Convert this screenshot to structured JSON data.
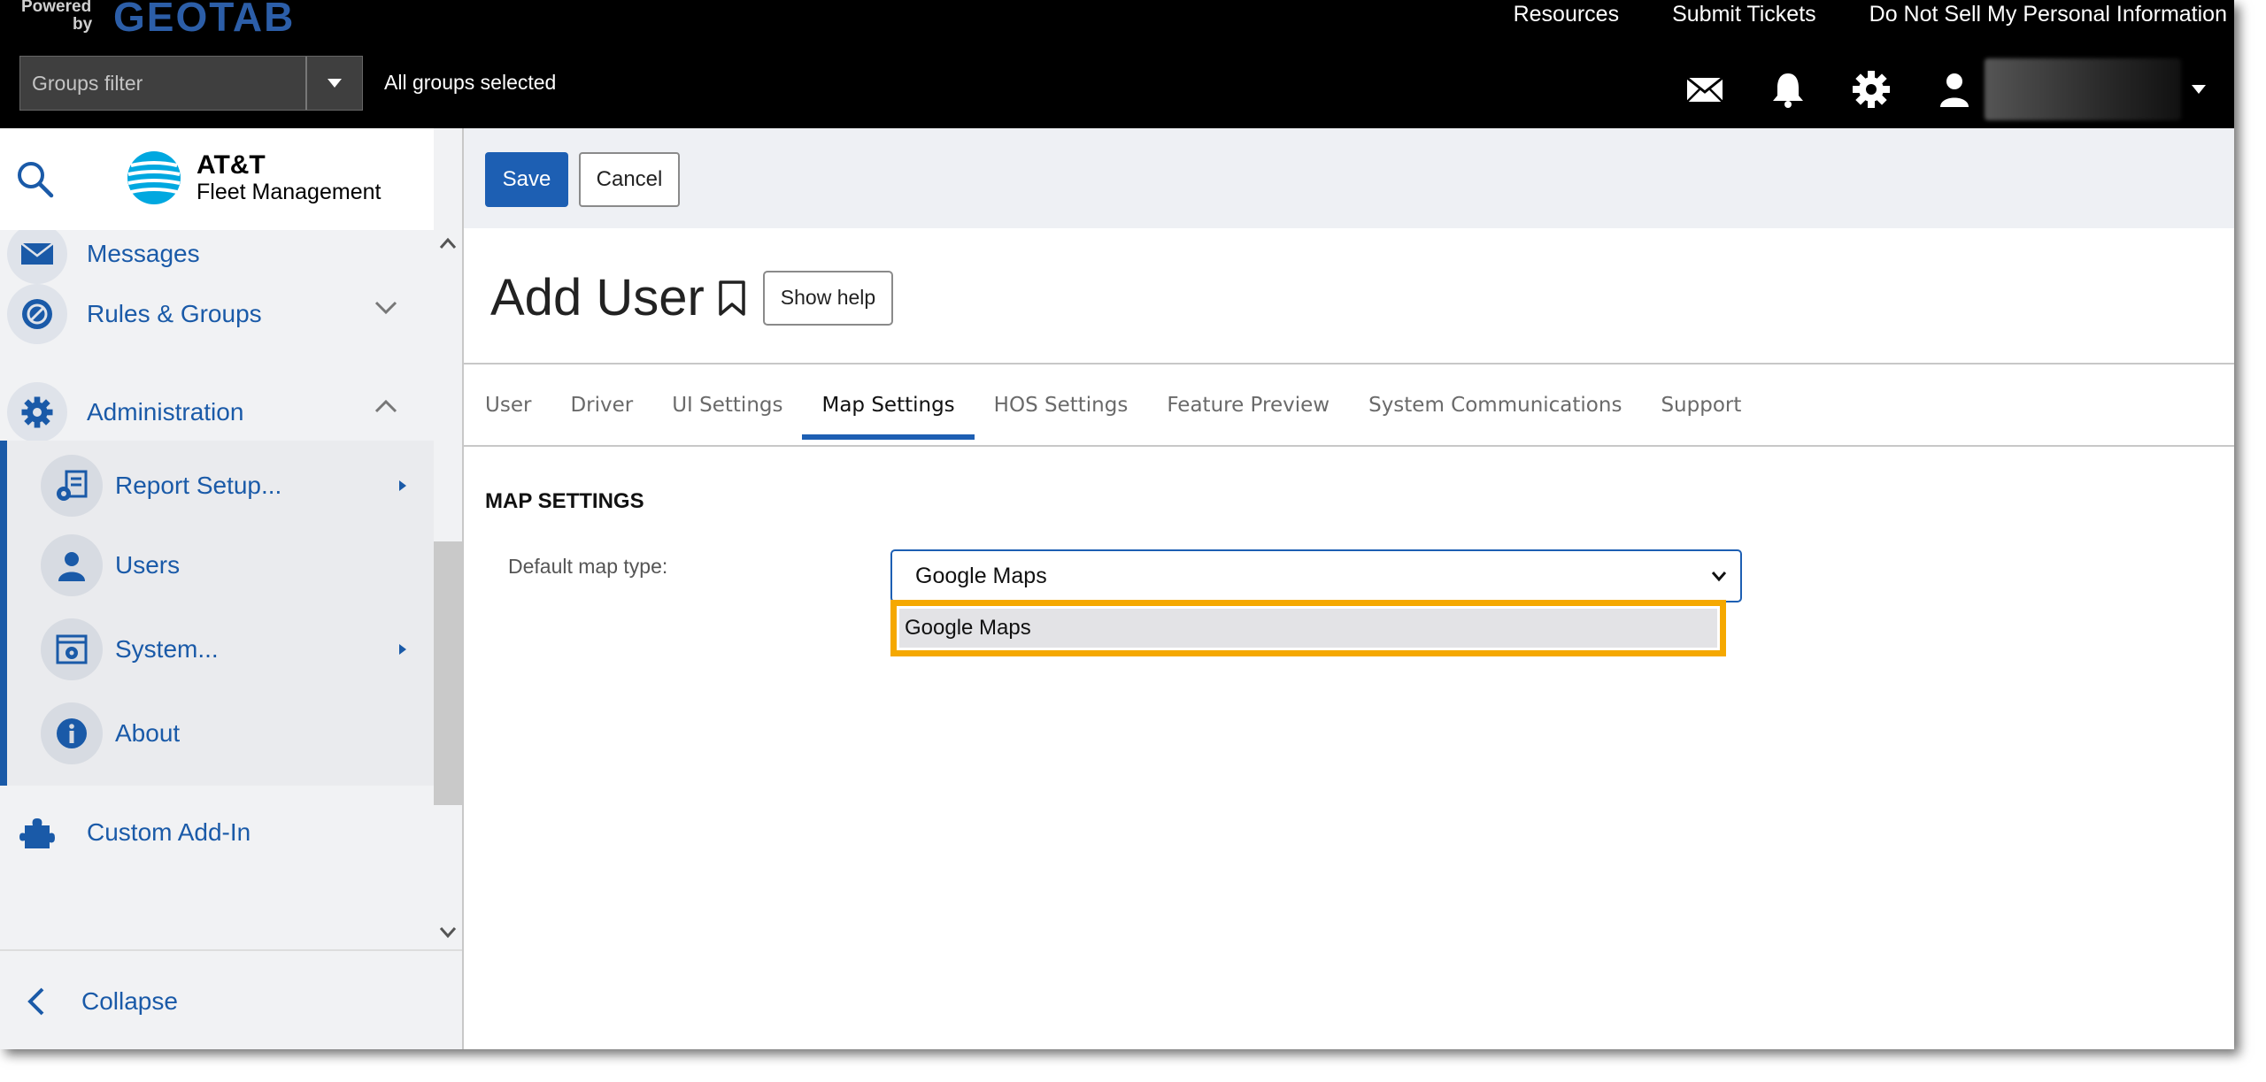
{
  "topbar": {
    "powered": "Powered",
    "by": "by",
    "brand": "GEOTAB",
    "links": [
      "Resources",
      "Submit Tickets",
      "Do Not Sell My Personal Information"
    ],
    "groups_filter_placeholder": "Groups filter",
    "groups_status": "All groups selected",
    "icons": [
      "mail-icon",
      "bell-icon",
      "gear-icon",
      "user-icon"
    ]
  },
  "sidebar": {
    "brand_line1": "AT&T",
    "brand_line2": "Fleet Management",
    "items": [
      {
        "label": "Messages",
        "icon": "envelope-icon"
      },
      {
        "label": "Rules & Groups",
        "icon": "rules-icon",
        "expanded": false
      },
      {
        "label": "Administration",
        "icon": "gear-icon",
        "expanded": true
      }
    ],
    "sub_items": [
      {
        "label": "Report Setup...",
        "icon": "report-setup-icon",
        "has_arrow": true
      },
      {
        "label": "Users",
        "icon": "person-icon",
        "has_arrow": false
      },
      {
        "label": "System...",
        "icon": "system-icon",
        "has_arrow": true
      },
      {
        "label": "About",
        "icon": "info-icon",
        "has_arrow": false
      }
    ],
    "after_items": [
      {
        "label": "Custom Add-In",
        "icon": "puzzle-icon"
      }
    ],
    "collapse_label": "Collapse"
  },
  "toolbar": {
    "save_label": "Save",
    "cancel_label": "Cancel"
  },
  "page": {
    "title": "Add User",
    "help_label": "Show help"
  },
  "tabs": [
    {
      "label": "User",
      "active": false
    },
    {
      "label": "Driver",
      "active": false
    },
    {
      "label": "UI Settings",
      "active": false
    },
    {
      "label": "Map Settings",
      "active": true
    },
    {
      "label": "HOS Settings",
      "active": false
    },
    {
      "label": "Feature Preview",
      "active": false
    },
    {
      "label": "System Communications",
      "active": false
    },
    {
      "label": "Support",
      "active": false
    }
  ],
  "map_settings": {
    "section_title": "MAP SETTINGS",
    "field_label": "Default map type:",
    "selected_value": "Google Maps",
    "options": [
      "Google Maps"
    ]
  },
  "colors": {
    "accent": "#1d5fb3",
    "highlight": "#f5a800",
    "topbar_bg": "#000000"
  }
}
